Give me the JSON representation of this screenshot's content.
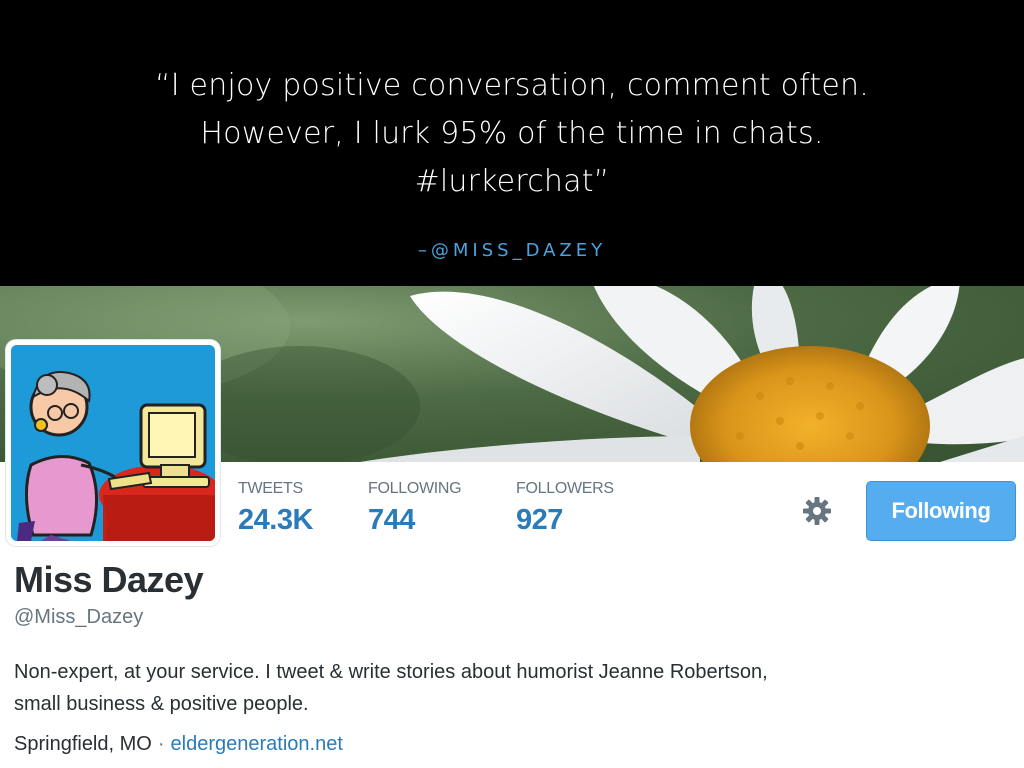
{
  "slide": {
    "quote_lines": [
      "“I enjoy positive conversation, comment often.",
      "However, I lurk 95% of the time in chats.",
      "#lurkerchat”"
    ],
    "attribution": "–@MISS_DAZEY",
    "attribution_color": "#4aa3df"
  },
  "profile": {
    "stats": [
      {
        "label": "TWEETS",
        "value": "24.3K"
      },
      {
        "label": "FOLLOWING",
        "value": "744"
      },
      {
        "label": "FOLLOWERS",
        "value": "927"
      }
    ],
    "settings_icon": "gear-icon",
    "follow_button_label": "Following",
    "name": "Miss Dazey",
    "handle": "@Miss_Dazey",
    "bio_lines": [
      "Non-expert, at your service.  I tweet & write stories about humorist Jeanne Robertson,",
      "small business & positive people."
    ],
    "location": "Springfield, MO",
    "separator": "·",
    "website": "eldergeneration.net",
    "colors": {
      "accent": "#55acee",
      "link": "#2b7bb9",
      "muted": "#66757f",
      "text": "#292f33"
    }
  }
}
